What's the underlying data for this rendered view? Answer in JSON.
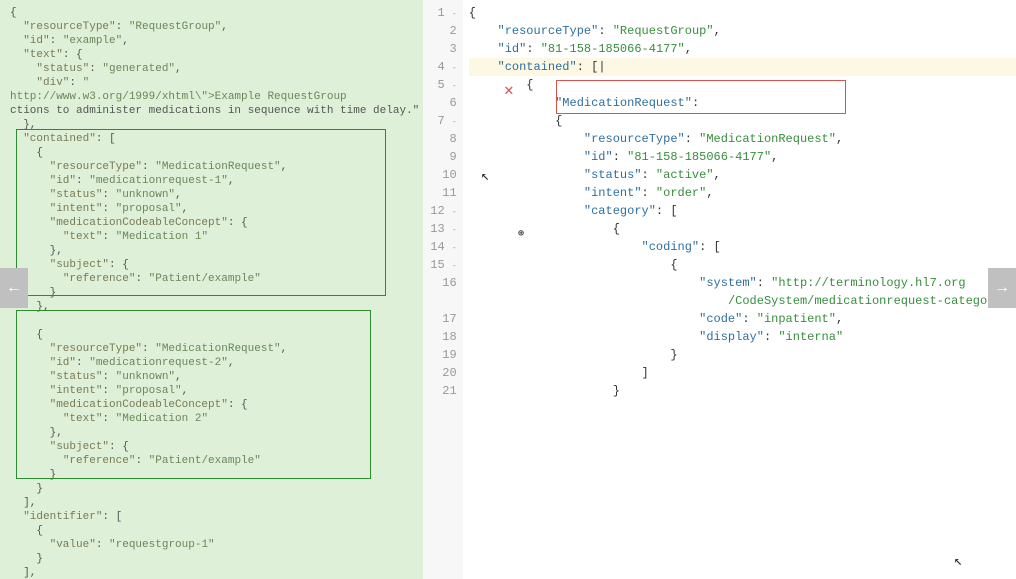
{
  "left": {
    "lines": [
      {
        "i": 0,
        "t": "{"
      },
      {
        "i": 1,
        "t": "\"resourceType\": \"RequestGroup\","
      },
      {
        "i": 1,
        "t": "\"id\": \"example\","
      },
      {
        "i": 1,
        "t": "\"text\": {"
      },
      {
        "i": 2,
        "t": "\"status\": \"generated\","
      },
      {
        "i": 2,
        "t": "\"div\": \"<div xmlns=\\\"http://www.w3.org/1999/xhtml\\\">Example RequestGroup"
      },
      {
        "i": 0,
        "t": "ctions to administer medications in sequence with time delay.</div>\""
      },
      {
        "i": 1,
        "t": "},"
      },
      {
        "i": 1,
        "t": "\"contained\": ["
      },
      {
        "i": 2,
        "t": "{"
      },
      {
        "i": 3,
        "t": "\"resourceType\": \"MedicationRequest\","
      },
      {
        "i": 3,
        "t": "\"id\": \"medicationrequest-1\","
      },
      {
        "i": 3,
        "t": "\"status\": \"unknown\","
      },
      {
        "i": 3,
        "t": "\"intent\": \"proposal\","
      },
      {
        "i": 3,
        "t": "\"medicationCodeableConcept\": {"
      },
      {
        "i": 4,
        "t": "\"text\": \"Medication 1\""
      },
      {
        "i": 3,
        "t": "},"
      },
      {
        "i": 3,
        "t": "\"subject\": {"
      },
      {
        "i": 4,
        "t": "\"reference\": \"Patient/example\""
      },
      {
        "i": 3,
        "t": "}"
      },
      {
        "i": 2,
        "t": "},"
      },
      {
        "i": 2,
        "t": ""
      },
      {
        "i": 2,
        "t": "{"
      },
      {
        "i": 3,
        "t": "\"resourceType\": \"MedicationRequest\","
      },
      {
        "i": 3,
        "t": "\"id\": \"medicationrequest-2\","
      },
      {
        "i": 3,
        "t": "\"status\": \"unknown\","
      },
      {
        "i": 3,
        "t": "\"intent\": \"proposal\","
      },
      {
        "i": 3,
        "t": "\"medicationCodeableConcept\": {"
      },
      {
        "i": 4,
        "t": "\"text\": \"Medication 2\""
      },
      {
        "i": 3,
        "t": "},"
      },
      {
        "i": 3,
        "t": "\"subject\": {"
      },
      {
        "i": 4,
        "t": "\"reference\": \"Patient/example\""
      },
      {
        "i": 3,
        "t": "}"
      },
      {
        "i": 2,
        "t": "}"
      },
      {
        "i": 1,
        "t": "],"
      },
      {
        "i": 1,
        "t": "\"identifier\": ["
      },
      {
        "i": 2,
        "t": "{"
      },
      {
        "i": 3,
        "t": "\"value\": \"requestgroup-1\""
      },
      {
        "i": 2,
        "t": "}"
      },
      {
        "i": 1,
        "t": "],"
      }
    ]
  },
  "right": {
    "lines": [
      {
        "n": "1",
        "f": "-",
        "seg": [
          {
            "c": "punc",
            "t": "{"
          }
        ]
      },
      {
        "n": "2",
        "seg": [
          {
            "c": "",
            "t": "    "
          },
          {
            "c": "key",
            "t": "\"resourceType\""
          },
          {
            "c": "punc",
            "t": ": "
          },
          {
            "c": "str",
            "t": "\"RequestGroup\""
          },
          {
            "c": "punc",
            "t": ","
          }
        ]
      },
      {
        "n": "3",
        "seg": [
          {
            "c": "",
            "t": "    "
          },
          {
            "c": "key",
            "t": "\"id\""
          },
          {
            "c": "punc",
            "t": ": "
          },
          {
            "c": "str",
            "t": "\"81-158-185066-4177\""
          },
          {
            "c": "punc",
            "t": ","
          }
        ]
      },
      {
        "n": "4",
        "f": "-",
        "hl": true,
        "seg": [
          {
            "c": "",
            "t": "    "
          },
          {
            "c": "key",
            "t": "\"contained\""
          },
          {
            "c": "punc",
            "t": ": [|"
          }
        ]
      },
      {
        "n": "5",
        "f": "-",
        "seg": [
          {
            "c": "",
            "t": "        "
          },
          {
            "c": "punc",
            "t": "{"
          }
        ]
      },
      {
        "n": "6",
        "seg": [
          {
            "c": "",
            "t": "            "
          },
          {
            "c": "key",
            "t": "\"MedicationRequest\""
          },
          {
            "c": "punc",
            "t": ":"
          }
        ]
      },
      {
        "n": "7",
        "f": "-",
        "seg": [
          {
            "c": "",
            "t": "            "
          },
          {
            "c": "punc",
            "t": "{"
          }
        ]
      },
      {
        "n": "8",
        "seg": [
          {
            "c": "",
            "t": "                "
          },
          {
            "c": "key",
            "t": "\"resourceType\""
          },
          {
            "c": "punc",
            "t": ": "
          },
          {
            "c": "str",
            "t": "\"MedicationRequest\""
          },
          {
            "c": "punc",
            "t": ","
          }
        ]
      },
      {
        "n": "9",
        "seg": [
          {
            "c": "",
            "t": "                "
          },
          {
            "c": "key",
            "t": "\"id\""
          },
          {
            "c": "punc",
            "t": ": "
          },
          {
            "c": "str",
            "t": "\"81-158-185066-4177\""
          },
          {
            "c": "punc",
            "t": ","
          }
        ]
      },
      {
        "n": "10",
        "seg": [
          {
            "c": "",
            "t": "                "
          },
          {
            "c": "key",
            "t": "\"status\""
          },
          {
            "c": "punc",
            "t": ": "
          },
          {
            "c": "str",
            "t": "\"active\""
          },
          {
            "c": "punc",
            "t": ","
          }
        ]
      },
      {
        "n": "11",
        "seg": [
          {
            "c": "",
            "t": "                "
          },
          {
            "c": "key",
            "t": "\"intent\""
          },
          {
            "c": "punc",
            "t": ": "
          },
          {
            "c": "str",
            "t": "\"order\""
          },
          {
            "c": "punc",
            "t": ","
          }
        ]
      },
      {
        "n": "12",
        "f": "-",
        "seg": [
          {
            "c": "",
            "t": "                "
          },
          {
            "c": "key",
            "t": "\"category\""
          },
          {
            "c": "punc",
            "t": ": ["
          }
        ]
      },
      {
        "n": "13",
        "f": "-",
        "seg": [
          {
            "c": "",
            "t": "                    "
          },
          {
            "c": "punc",
            "t": "{"
          }
        ]
      },
      {
        "n": "14",
        "f": "-",
        "seg": [
          {
            "c": "",
            "t": "                        "
          },
          {
            "c": "key",
            "t": "\"coding\""
          },
          {
            "c": "punc",
            "t": ": ["
          }
        ]
      },
      {
        "n": "15",
        "f": "-",
        "seg": [
          {
            "c": "",
            "t": "                            "
          },
          {
            "c": "punc",
            "t": "{"
          }
        ]
      },
      {
        "n": "16",
        "seg": [
          {
            "c": "",
            "t": "                                "
          },
          {
            "c": "key",
            "t": "\"system\""
          },
          {
            "c": "punc",
            "t": ": "
          },
          {
            "c": "str",
            "t": "\"http://terminology.hl7.org"
          }
        ]
      },
      {
        "n": "",
        "seg": [
          {
            "c": "",
            "t": "                                    "
          },
          {
            "c": "str",
            "t": "/CodeSystem/medicationrequest-category\""
          },
          {
            "c": "punc",
            "t": ","
          }
        ]
      },
      {
        "n": "17",
        "seg": [
          {
            "c": "",
            "t": "                                "
          },
          {
            "c": "key",
            "t": "\"code\""
          },
          {
            "c": "punc",
            "t": ": "
          },
          {
            "c": "str",
            "t": "\"inpatient\""
          },
          {
            "c": "punc",
            "t": ","
          }
        ]
      },
      {
        "n": "18",
        "seg": [
          {
            "c": "",
            "t": "                                "
          },
          {
            "c": "key",
            "t": "\"display\""
          },
          {
            "c": "punc",
            "t": ": "
          },
          {
            "c": "str",
            "t": "\"interna\""
          }
        ]
      },
      {
        "n": "19",
        "seg": [
          {
            "c": "",
            "t": "                            "
          },
          {
            "c": "punc",
            "t": "}"
          }
        ]
      },
      {
        "n": "20",
        "seg": [
          {
            "c": "",
            "t": "                        "
          },
          {
            "c": "punc",
            "t": "]"
          }
        ]
      },
      {
        "n": "21",
        "seg": [
          {
            "c": "",
            "t": "                    "
          },
          {
            "c": "punc",
            "t": "}"
          }
        ]
      }
    ]
  },
  "nav": {
    "left_icon": "←",
    "right_icon": "→"
  }
}
